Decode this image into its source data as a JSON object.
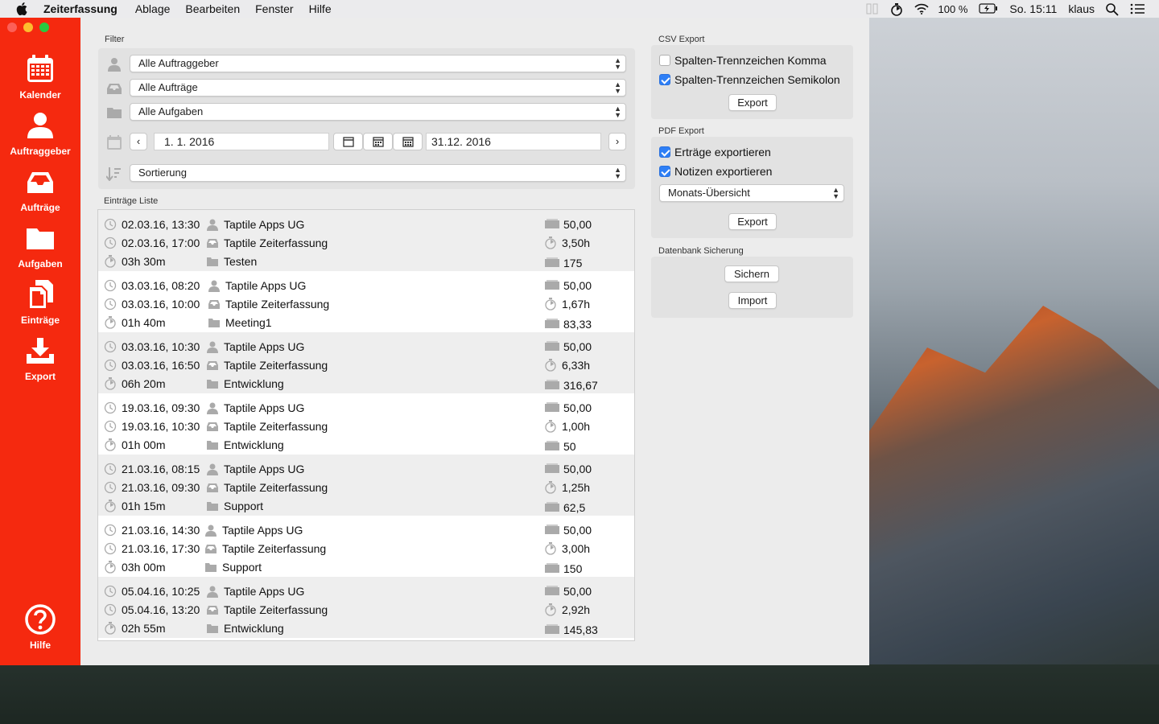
{
  "menubar": {
    "app_name": "Zeiterfassung",
    "menus": [
      "Ablage",
      "Bearbeiten",
      "Fenster",
      "Hilfe"
    ],
    "battery": "100 %",
    "clock": "So. 15:11",
    "user": "klaus"
  },
  "sidebar": {
    "items": [
      {
        "label": "Kalender",
        "icon": "calendar-icon"
      },
      {
        "label": "Auftraggeber",
        "icon": "person-icon"
      },
      {
        "label": "Aufträge",
        "icon": "inbox-tray-icon"
      },
      {
        "label": "Aufgaben",
        "icon": "folder-icon"
      },
      {
        "label": "Einträge",
        "icon": "documents-icon"
      },
      {
        "label": "Export",
        "icon": "download-icon"
      }
    ],
    "help_label": "Hilfe"
  },
  "filter": {
    "title": "Filter",
    "client": "Alle Auftraggeber",
    "order": "Alle Aufträge",
    "task": "Alle Aufgaben",
    "date_from": "1.  1. 2016",
    "date_to": "31.12. 2016",
    "sort": "Sortierung"
  },
  "list": {
    "title": "Einträge Liste",
    "entries": [
      {
        "start": "02.03.16, 13:30",
        "end": "02.03.16, 17:00",
        "duration": "03h 30m",
        "client": "Taptile Apps UG",
        "order": "Taptile Zeiterfassung",
        "task": "Testen",
        "rate": "50,00",
        "hours": "3,50h",
        "amount": "175"
      },
      {
        "start": "03.03.16, 08:20",
        "end": "03.03.16, 10:00",
        "duration": "01h 40m",
        "client": "Taptile Apps UG",
        "order": "Taptile Zeiterfassung",
        "task": "Meeting1",
        "rate": "50,00",
        "hours": "1,67h",
        "amount": "83,33"
      },
      {
        "start": "03.03.16, 10:30",
        "end": "03.03.16, 16:50",
        "duration": "06h 20m",
        "client": "Taptile Apps UG",
        "order": "Taptile Zeiterfassung",
        "task": "Entwicklung",
        "rate": "50,00",
        "hours": "6,33h",
        "amount": "316,67"
      },
      {
        "start": "19.03.16, 09:30",
        "end": "19.03.16, 10:30",
        "duration": "01h 00m",
        "client": "Taptile Apps UG",
        "order": "Taptile Zeiterfassung",
        "task": "Entwicklung",
        "rate": "50,00",
        "hours": "1,00h",
        "amount": "50"
      },
      {
        "start": "21.03.16, 08:15",
        "end": "21.03.16, 09:30",
        "duration": "01h 15m",
        "client": "Taptile Apps UG",
        "order": "Taptile Zeiterfassung",
        "task": "Support",
        "rate": "50,00",
        "hours": "1,25h",
        "amount": "62,5"
      },
      {
        "start": "21.03.16, 14:30",
        "end": "21.03.16, 17:30",
        "duration": "03h 00m",
        "client": "Taptile Apps UG",
        "order": "Taptile Zeiterfassung",
        "task": "Support",
        "rate": "50,00",
        "hours": "3,00h",
        "amount": "150"
      },
      {
        "start": "05.04.16, 10:25",
        "end": "05.04.16, 13:20",
        "duration": "02h 55m",
        "client": "Taptile Apps UG",
        "order": "Taptile Zeiterfassung",
        "task": "Entwicklung",
        "rate": "50,00",
        "hours": "2,92h",
        "amount": "145,83"
      }
    ]
  },
  "csv": {
    "title": "CSV Export",
    "opt_comma": "Spalten-Trennzeichen Komma",
    "opt_comma_checked": false,
    "opt_semicolon": "Spalten-Trennzeichen Semikolon",
    "opt_semicolon_checked": true,
    "export_label": "Export"
  },
  "pdf": {
    "title": "PDF Export",
    "opt_income": "Erträge exportieren",
    "opt_income_checked": true,
    "opt_notes": "Notizen exportieren",
    "opt_notes_checked": true,
    "view": "Monats-Übersicht",
    "export_label": "Export"
  },
  "backup": {
    "title": "Datenbank Sicherung",
    "save_label": "Sichern",
    "import_label": "Import"
  },
  "colors": {
    "sidebar": "#f5290f",
    "checkbox": "#2e7ff6"
  }
}
